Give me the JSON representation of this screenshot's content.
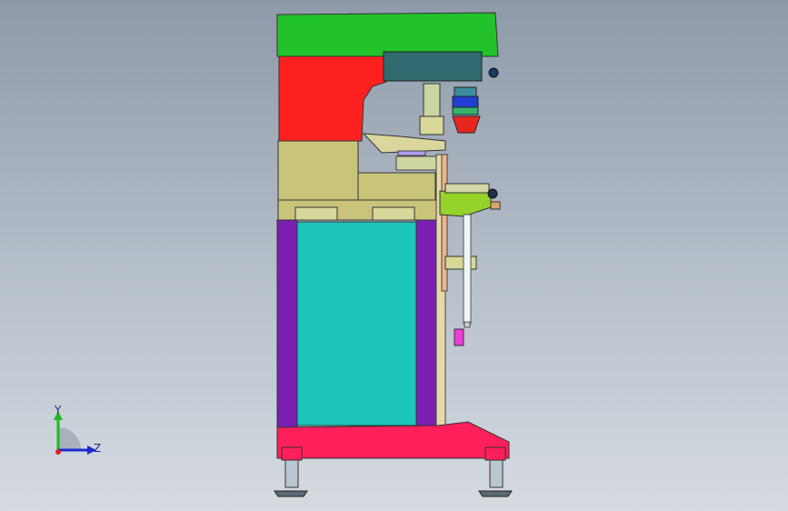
{
  "triad": {
    "y_label": "Y",
    "z_label": "Z"
  },
  "colors": {
    "background_top": "#8e9aa9",
    "background_bottom": "#d6dbe1",
    "top_arm": "#22c22b",
    "neck_block": "#ff2020",
    "body_block": "#c8c47a",
    "legs": "#7a1fb0",
    "cabinet_panel": "#1cc6b8",
    "base": "#ff1f5a",
    "control_box": "#2f6b70",
    "pad_cup": "#e8261e",
    "y_axis": "#1fb81f",
    "z_axis": "#1b2ad1"
  }
}
